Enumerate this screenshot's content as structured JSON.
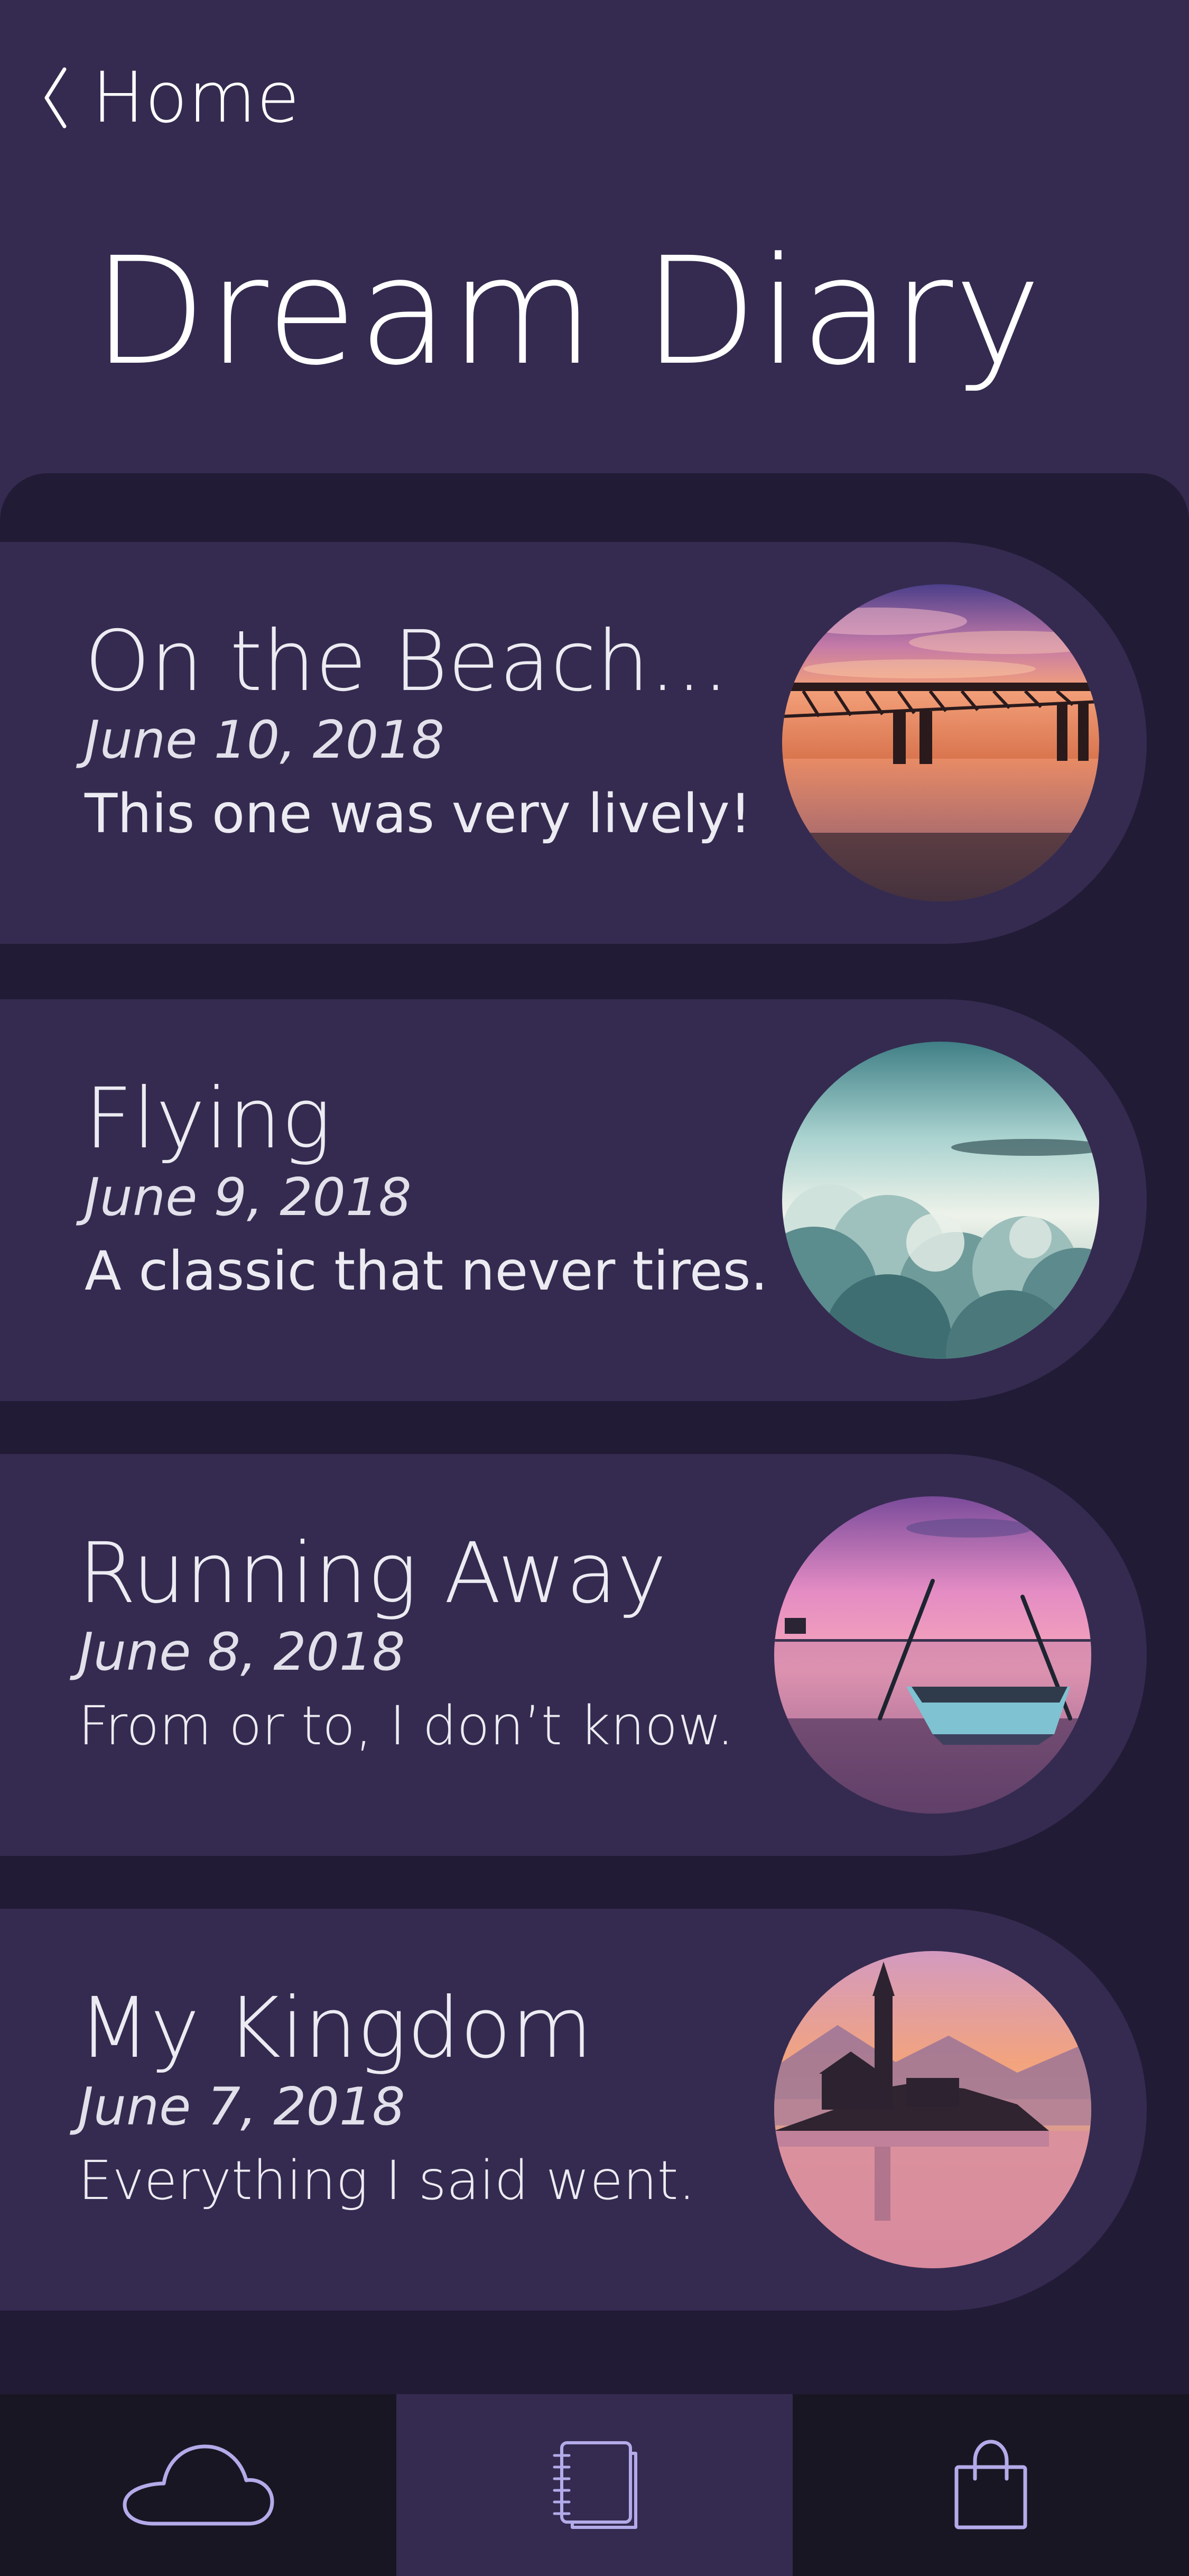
{
  "nav": {
    "back_label": "Home",
    "back_icon": "chevron-left-icon"
  },
  "page": {
    "title": "Dream Diary"
  },
  "entries": [
    {
      "title": "On the Beach...",
      "date": "June 10, 2018",
      "note": "This one was very lively!",
      "photo": "sunset-pier-photo"
    },
    {
      "title": "Flying",
      "date": "June 9, 2018",
      "note": "A classic that never tires.",
      "photo": "clouds-sky-photo"
    },
    {
      "title": "Running Away",
      "date": "June 8, 2018",
      "note": "From or to, I don’t know.",
      "photo": "rowboat-lake-photo"
    },
    {
      "title": "My Kingdom",
      "date": "June 7, 2018",
      "note": "Everything I said went.",
      "photo": "island-church-photo"
    }
  ],
  "tabs": [
    {
      "icon": "cloud-icon",
      "active": false
    },
    {
      "icon": "notebook-icon",
      "active": true
    },
    {
      "icon": "shopping-bag-icon",
      "active": false
    }
  ],
  "colors": {
    "background": "#352b50",
    "list_background": "#221b36",
    "tab_bar": "#191624",
    "icon_stroke": "#b3abe9"
  }
}
